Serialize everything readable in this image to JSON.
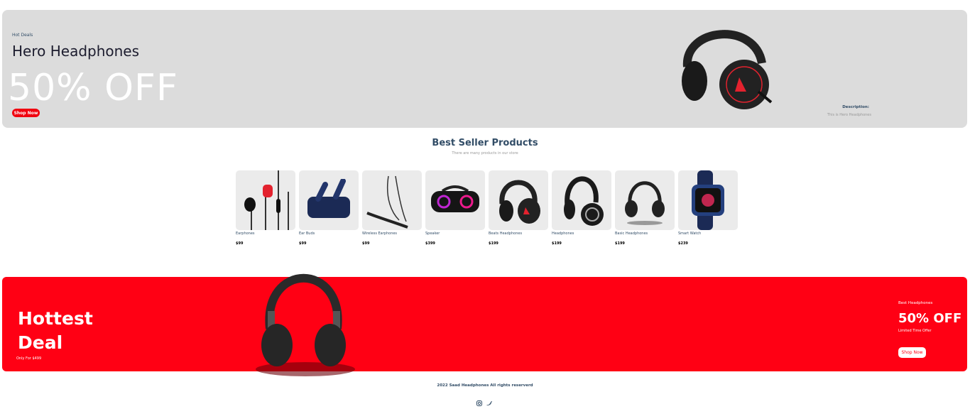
{
  "hero": {
    "eyebrow": "Hot Deals",
    "title": "Hero Headphones",
    "big_text": "50% OFF",
    "button": "Shop Now",
    "desc_title": "Description:",
    "desc_text": "This is Hero Headphones"
  },
  "best": {
    "title": "Best Seller Products",
    "subtitle": "There are many products in our store"
  },
  "products": [
    {
      "name": "Earphones",
      "price": "$99",
      "icon": "earphones"
    },
    {
      "name": "Ear Buds",
      "price": "$99",
      "icon": "earbuds"
    },
    {
      "name": "Wireless Earphones",
      "price": "$99",
      "icon": "neckband"
    },
    {
      "name": "Speaker",
      "price": "$399",
      "icon": "speaker"
    },
    {
      "name": "Beats Headphones",
      "price": "$199",
      "icon": "headphones"
    },
    {
      "name": "Headphones",
      "price": "$199",
      "icon": "headphones"
    },
    {
      "name": "Basic Headphones",
      "price": "$199",
      "icon": "headphones"
    },
    {
      "name": "Smart Watch",
      "price": "$239",
      "icon": "watch"
    }
  ],
  "deal": {
    "title_line1": "Hottest",
    "title_line2": "Deal",
    "only_for": "Only For $499",
    "small": "Best Headphones",
    "big": "50% OFF",
    "limited": "Limited Time Offer",
    "button": "Shop Now"
  },
  "footer": {
    "copyright": "2022 Saad Headphones All rights reserverd",
    "icons": [
      "instagram-icon",
      "twitter-icon"
    ]
  },
  "colors": {
    "accent": "#ff0014",
    "heading": "#324d67",
    "hero_bg": "#dcdcdc"
  }
}
